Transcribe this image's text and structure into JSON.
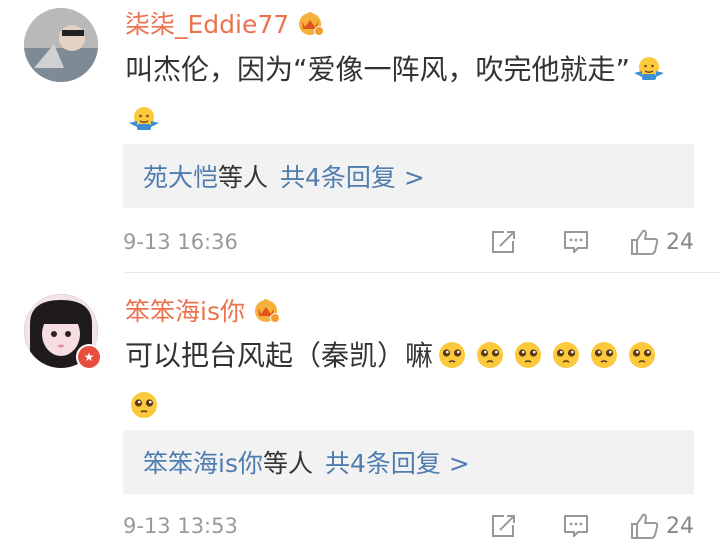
{
  "comments": [
    {
      "username": "柒柒_Eddie77",
      "text": "叫杰伦，因为“爱像一阵风，吹完他就走”",
      "emoji": "shrug-emoji",
      "reply_users": "苑大恺",
      "reply_suffix": "等人",
      "reply_count": "共4条回复 >",
      "time": "9-13 16:36",
      "likes": "24"
    },
    {
      "username": "笨笨海is你",
      "text": "可以把台风起（秦凯）嘛",
      "emoji": "pleading-emoji",
      "reply_users": "笨笨海is你",
      "reply_suffix": "等人",
      "reply_count": "共4条回复 >",
      "time": "9-13 13:53",
      "likes": "24"
    }
  ],
  "colors": {
    "username": "#eb7350",
    "link": "#507daf",
    "meta": "#999999",
    "reply_bg": "#f2f2f2",
    "crown": "#f6b13d"
  }
}
